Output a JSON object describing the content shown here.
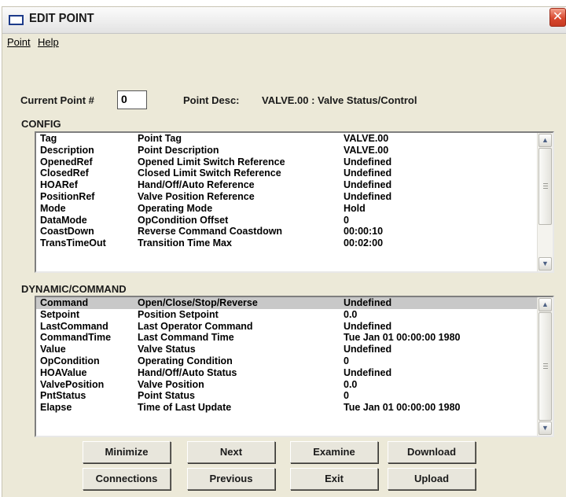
{
  "window": {
    "title": "EDIT POINT",
    "close_glyph": "✕"
  },
  "menu": {
    "point": "Point",
    "help": "Help"
  },
  "current_point": {
    "label": "Current Point #",
    "value": "0"
  },
  "point_desc": {
    "label": "Point Desc:",
    "value": "VALVE.00 : Valve Status/Control"
  },
  "config": {
    "title": "CONFIG",
    "rows": [
      [
        "Tag",
        "Point Tag",
        "VALVE.00"
      ],
      [
        "Description",
        "Point Description",
        "VALVE.00"
      ],
      [
        "OpenedRef",
        "Opened Limit Switch Reference",
        "Undefined"
      ],
      [
        "ClosedRef",
        "Closed Limit Switch Reference",
        "Undefined"
      ],
      [
        "HOARef",
        "Hand/Off/Auto Reference",
        "Undefined"
      ],
      [
        "PositionRef",
        "Valve Position Reference",
        "Undefined"
      ],
      [
        "Mode",
        "Operating Mode",
        "Hold"
      ],
      [
        "DataMode",
        "OpCondition Offset",
        "0"
      ],
      [
        "CoastDown",
        "Reverse Command Coastdown",
        "00:00:10"
      ],
      [
        "TransTimeOut",
        "Transition Time Max",
        "00:02:00"
      ]
    ]
  },
  "dynamic": {
    "title": "DYNAMIC/COMMAND",
    "rows": [
      [
        "Command",
        "Open/Close/Stop/Reverse",
        "Undefined"
      ],
      [
        "Setpoint",
        "Position Setpoint",
        "0.0"
      ],
      [
        "LastCommand",
        "Last Operator Command",
        "Undefined"
      ],
      [
        "CommandTime",
        "Last Command Time",
        "Tue Jan 01 00:00:00 1980"
      ],
      [
        "Value",
        "Valve Status",
        "Undefined"
      ],
      [
        "OpCondition",
        "Operating Condition",
        "0"
      ],
      [
        "HOAValue",
        "Hand/Off/Auto Status",
        "Undefined"
      ],
      [
        "ValvePosition",
        "Valve Position",
        "0.0"
      ],
      [
        "PntStatus",
        "Point Status",
        "0"
      ],
      [
        "Elapse",
        "Time of Last Update",
        "Tue Jan 01 00:00:00 1980"
      ]
    ]
  },
  "buttons": {
    "minimize": "Minimize",
    "next": "Next",
    "examine": "Examine",
    "download": "Download",
    "connections": "Connections",
    "previous": "Previous",
    "exit": "Exit",
    "upload": "Upload"
  },
  "icons": {
    "scroll_up": "up-arrow-icon",
    "scroll_down": "down-arrow-icon",
    "window": "window-icon"
  }
}
